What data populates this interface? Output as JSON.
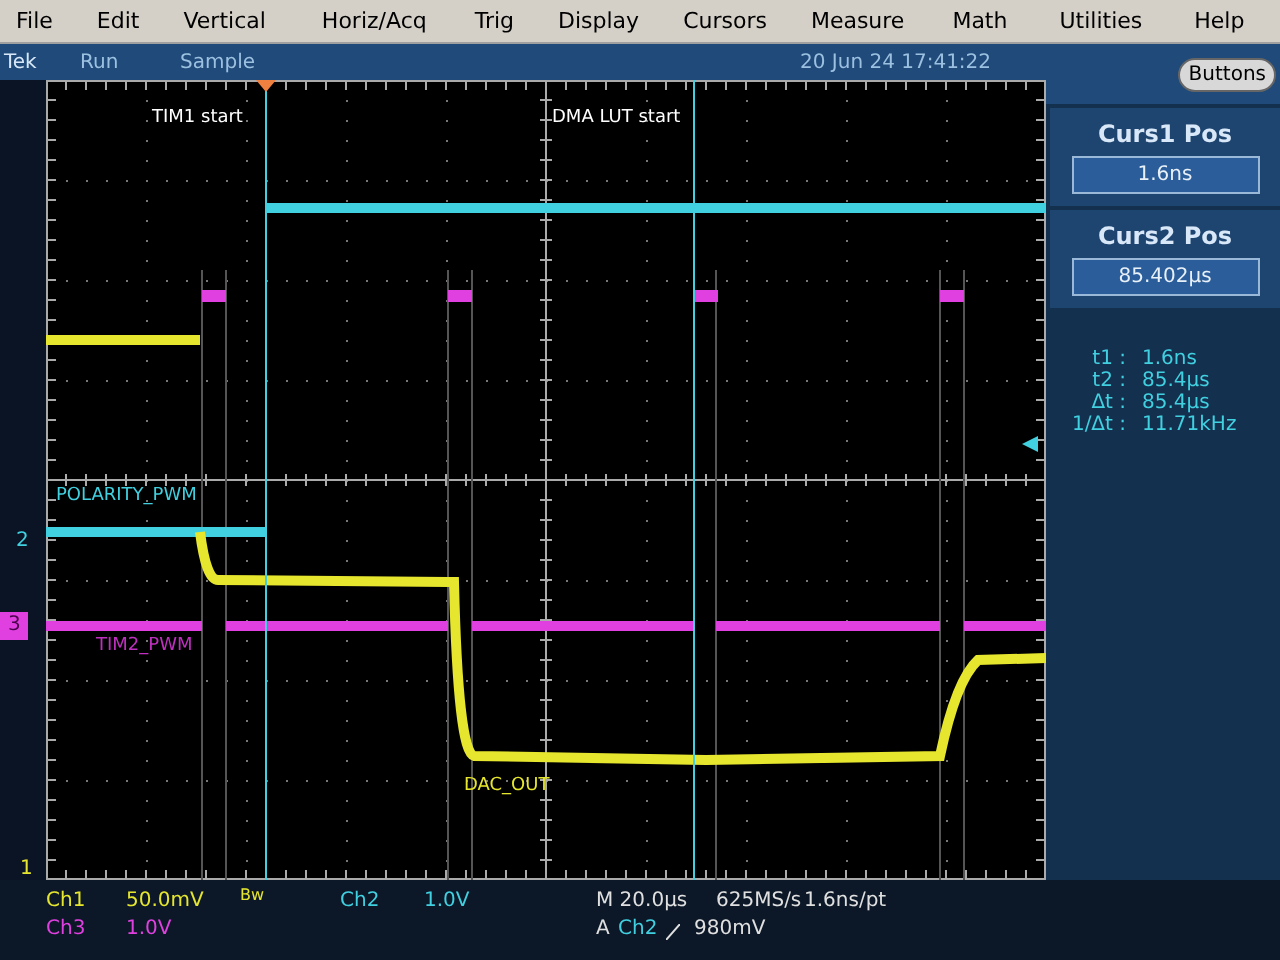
{
  "menu": [
    "File",
    "Edit",
    "Vertical",
    "Horiz/Acq",
    "Trig",
    "Display",
    "Cursors",
    "Measure",
    "Math",
    "Utilities",
    "Help"
  ],
  "status": {
    "brand": "Tek",
    "state": "Run",
    "mode": "Sample",
    "datetime": "20 Jun 24 17:41:22"
  },
  "panel_button": "Buttons",
  "cursor_positions": [
    {
      "label": "Curs1 Pos",
      "value": "1.6ns"
    },
    {
      "label": "Curs2 Pos",
      "value": "85.402µs"
    }
  ],
  "cursor_readouts": [
    {
      "label": "t1 :",
      "value": "1.6ns"
    },
    {
      "label": "t2 :",
      "value": "85.4µs"
    },
    {
      "label": "Δt :",
      "value": "85.4µs"
    },
    {
      "label": "1/Δt :",
      "value": "11.71kHz"
    }
  ],
  "trace_labels": [
    {
      "text": "TIM1 start",
      "color": "#ffffff"
    },
    {
      "text": "DMA LUT start",
      "color": "#ffffff"
    },
    {
      "text": "POLARITY_PWM",
      "color": "#40d0e0"
    },
    {
      "text": "TIM2_PWM",
      "color": "#c030c0"
    },
    {
      "text": "DAC_OUT",
      "color": "#e6e62e"
    }
  ],
  "channel_markers": [
    {
      "label": "2",
      "color": "#40d0e0",
      "selected": false
    },
    {
      "label": "3",
      "color": "#e040e0",
      "selected": true
    },
    {
      "label": "1",
      "color": "#e6e62e",
      "selected": false
    }
  ],
  "channels": [
    {
      "name": "Ch1",
      "scale": "50.0mV",
      "bandwidth_limit": "Bw",
      "color": "#e6e62e"
    },
    {
      "name": "Ch2",
      "scale": "1.0V",
      "color": "#40d0e0"
    },
    {
      "name": "Ch3",
      "scale": "1.0V",
      "color": "#e040e0"
    }
  ],
  "timebase": {
    "scale": "M 20.0µs",
    "rate": "625MS/s",
    "resolution": "1.6ns/pt"
  },
  "trigger": {
    "prefix": "A",
    "source": "Ch2",
    "level": "980mV"
  }
}
